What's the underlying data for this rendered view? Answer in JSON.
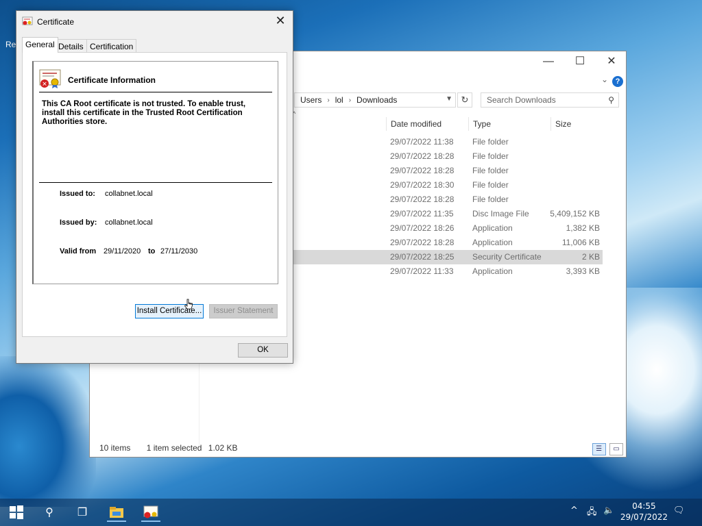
{
  "desktop": {
    "label_fragment": "Re"
  },
  "explorer": {
    "controls": {
      "minimize": "—",
      "maximize": "☐",
      "close": "✕"
    },
    "help": "?",
    "breadcrumb": [
      "Users",
      "lol",
      "Downloads"
    ],
    "search_placeholder": "Search Downloads",
    "columns": {
      "date": "Date modified",
      "type": "Type",
      "size": "Size"
    },
    "rows": [
      {
        "date": "29/07/2022 11:38",
        "type": "File folder",
        "size": ""
      },
      {
        "date": "29/07/2022 18:28",
        "type": "File folder",
        "size": ""
      },
      {
        "date": "29/07/2022 18:28",
        "type": "File folder",
        "size": ""
      },
      {
        "date": "29/07/2022 18:30",
        "type": "File folder",
        "size": ""
      },
      {
        "date": "29/07/2022 18:28",
        "type": "File folder",
        "size": ""
      },
      {
        "date": "29/07/2022 11:35",
        "type": "Disc Image File",
        "size": "5,409,152 KB"
      },
      {
        "date": "29/07/2022 18:26",
        "type": "Application",
        "size": "1,382 KB"
      },
      {
        "date": "29/07/2022 18:28",
        "type": "Application",
        "size": "11,006 KB"
      },
      {
        "date": "29/07/2022 18:25",
        "type": "Security Certificate",
        "size": "2 KB",
        "selected": true
      },
      {
        "date": "29/07/2022 11:33",
        "type": "Application",
        "size": "3,393 KB"
      }
    ],
    "status": {
      "items": "10 items",
      "selected": "1 item selected",
      "size": "1.02 KB"
    }
  },
  "certificate": {
    "title": "Certificate",
    "close": "✕",
    "tabs": [
      "General",
      "Details",
      "Certification Path"
    ],
    "info_title": "Certificate Information",
    "warning": "This CA Root certificate is not trusted. To enable trust, install this certificate in the Trusted Root Certification Authorities store.",
    "issued_to_label": "Issued to:",
    "issued_to": "collabnet.local",
    "issued_by_label": "Issued by:",
    "issued_by": "collabnet.local",
    "valid_from_label": "Valid from",
    "valid_from": "29/11/2020",
    "to_label": "to",
    "valid_to": "27/11/2030",
    "install_button": "Install Certificate...",
    "issuer_button": "Issuer Statement",
    "ok_button": "OK"
  },
  "taskbar": {
    "time": "04:55",
    "date": "29/07/2022"
  }
}
